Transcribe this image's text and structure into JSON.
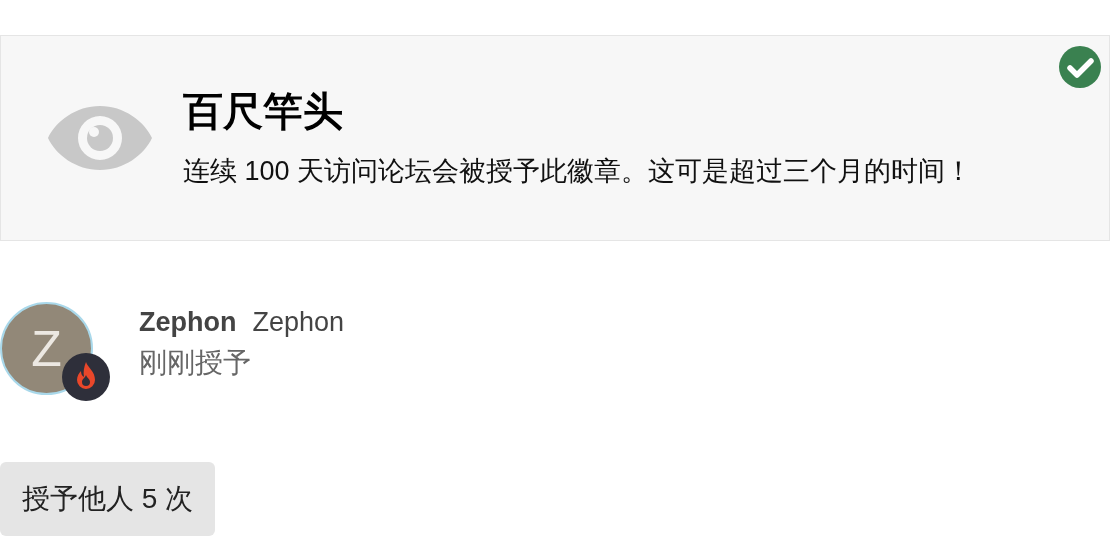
{
  "badge": {
    "title": "百尺竿头",
    "description": "连续 100 天访问论坛会被授予此徽章。这可是超过三个月的时间！",
    "granted": true
  },
  "grant": {
    "avatar_letter": "Z",
    "username": "Zephon",
    "name": "Zephon",
    "time": "刚刚授予"
  },
  "grant_count_button": "授予他人 5 次"
}
